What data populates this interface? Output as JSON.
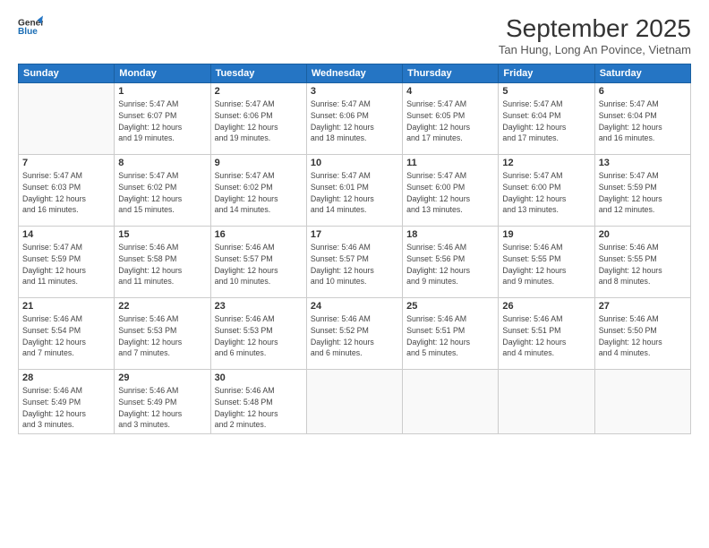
{
  "header": {
    "logo_line1": "General",
    "logo_line2": "Blue",
    "month": "September 2025",
    "location": "Tan Hung, Long An Povince, Vietnam"
  },
  "weekdays": [
    "Sunday",
    "Monday",
    "Tuesday",
    "Wednesday",
    "Thursday",
    "Friday",
    "Saturday"
  ],
  "weeks": [
    [
      {
        "day": "",
        "info": ""
      },
      {
        "day": "1",
        "info": "Sunrise: 5:47 AM\nSunset: 6:07 PM\nDaylight: 12 hours\nand 19 minutes."
      },
      {
        "day": "2",
        "info": "Sunrise: 5:47 AM\nSunset: 6:06 PM\nDaylight: 12 hours\nand 19 minutes."
      },
      {
        "day": "3",
        "info": "Sunrise: 5:47 AM\nSunset: 6:06 PM\nDaylight: 12 hours\nand 18 minutes."
      },
      {
        "day": "4",
        "info": "Sunrise: 5:47 AM\nSunset: 6:05 PM\nDaylight: 12 hours\nand 17 minutes."
      },
      {
        "day": "5",
        "info": "Sunrise: 5:47 AM\nSunset: 6:04 PM\nDaylight: 12 hours\nand 17 minutes."
      },
      {
        "day": "6",
        "info": "Sunrise: 5:47 AM\nSunset: 6:04 PM\nDaylight: 12 hours\nand 16 minutes."
      }
    ],
    [
      {
        "day": "7",
        "info": "Sunrise: 5:47 AM\nSunset: 6:03 PM\nDaylight: 12 hours\nand 16 minutes."
      },
      {
        "day": "8",
        "info": "Sunrise: 5:47 AM\nSunset: 6:02 PM\nDaylight: 12 hours\nand 15 minutes."
      },
      {
        "day": "9",
        "info": "Sunrise: 5:47 AM\nSunset: 6:02 PM\nDaylight: 12 hours\nand 14 minutes."
      },
      {
        "day": "10",
        "info": "Sunrise: 5:47 AM\nSunset: 6:01 PM\nDaylight: 12 hours\nand 14 minutes."
      },
      {
        "day": "11",
        "info": "Sunrise: 5:47 AM\nSunset: 6:00 PM\nDaylight: 12 hours\nand 13 minutes."
      },
      {
        "day": "12",
        "info": "Sunrise: 5:47 AM\nSunset: 6:00 PM\nDaylight: 12 hours\nand 13 minutes."
      },
      {
        "day": "13",
        "info": "Sunrise: 5:47 AM\nSunset: 5:59 PM\nDaylight: 12 hours\nand 12 minutes."
      }
    ],
    [
      {
        "day": "14",
        "info": "Sunrise: 5:47 AM\nSunset: 5:59 PM\nDaylight: 12 hours\nand 11 minutes."
      },
      {
        "day": "15",
        "info": "Sunrise: 5:46 AM\nSunset: 5:58 PM\nDaylight: 12 hours\nand 11 minutes."
      },
      {
        "day": "16",
        "info": "Sunrise: 5:46 AM\nSunset: 5:57 PM\nDaylight: 12 hours\nand 10 minutes."
      },
      {
        "day": "17",
        "info": "Sunrise: 5:46 AM\nSunset: 5:57 PM\nDaylight: 12 hours\nand 10 minutes."
      },
      {
        "day": "18",
        "info": "Sunrise: 5:46 AM\nSunset: 5:56 PM\nDaylight: 12 hours\nand 9 minutes."
      },
      {
        "day": "19",
        "info": "Sunrise: 5:46 AM\nSunset: 5:55 PM\nDaylight: 12 hours\nand 9 minutes."
      },
      {
        "day": "20",
        "info": "Sunrise: 5:46 AM\nSunset: 5:55 PM\nDaylight: 12 hours\nand 8 minutes."
      }
    ],
    [
      {
        "day": "21",
        "info": "Sunrise: 5:46 AM\nSunset: 5:54 PM\nDaylight: 12 hours\nand 7 minutes."
      },
      {
        "day": "22",
        "info": "Sunrise: 5:46 AM\nSunset: 5:53 PM\nDaylight: 12 hours\nand 7 minutes."
      },
      {
        "day": "23",
        "info": "Sunrise: 5:46 AM\nSunset: 5:53 PM\nDaylight: 12 hours\nand 6 minutes."
      },
      {
        "day": "24",
        "info": "Sunrise: 5:46 AM\nSunset: 5:52 PM\nDaylight: 12 hours\nand 6 minutes."
      },
      {
        "day": "25",
        "info": "Sunrise: 5:46 AM\nSunset: 5:51 PM\nDaylight: 12 hours\nand 5 minutes."
      },
      {
        "day": "26",
        "info": "Sunrise: 5:46 AM\nSunset: 5:51 PM\nDaylight: 12 hours\nand 4 minutes."
      },
      {
        "day": "27",
        "info": "Sunrise: 5:46 AM\nSunset: 5:50 PM\nDaylight: 12 hours\nand 4 minutes."
      }
    ],
    [
      {
        "day": "28",
        "info": "Sunrise: 5:46 AM\nSunset: 5:49 PM\nDaylight: 12 hours\nand 3 minutes."
      },
      {
        "day": "29",
        "info": "Sunrise: 5:46 AM\nSunset: 5:49 PM\nDaylight: 12 hours\nand 3 minutes."
      },
      {
        "day": "30",
        "info": "Sunrise: 5:46 AM\nSunset: 5:48 PM\nDaylight: 12 hours\nand 2 minutes."
      },
      {
        "day": "",
        "info": ""
      },
      {
        "day": "",
        "info": ""
      },
      {
        "day": "",
        "info": ""
      },
      {
        "day": "",
        "info": ""
      }
    ]
  ]
}
